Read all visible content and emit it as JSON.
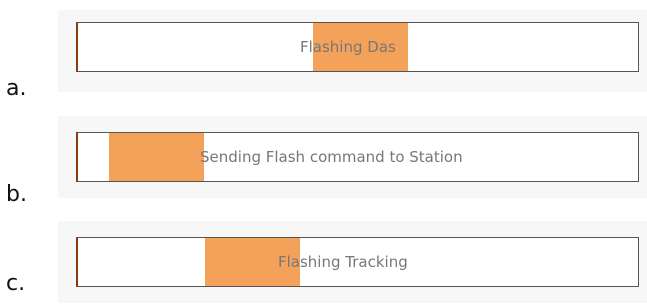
{
  "items": [
    {
      "label": "a.",
      "status_text": "Flashing Das",
      "segment_start_fraction": 0.42,
      "segment_width_fraction": 0.17
    },
    {
      "label": "b.",
      "status_text": "Sending Flash command to Station",
      "segment_start_fraction": 0.055,
      "segment_width_fraction": 0.17
    },
    {
      "label": "c.",
      "status_text": "Flashing Tracking",
      "segment_start_fraction": 0.226,
      "segment_width_fraction": 0.17
    }
  ],
  "colors": {
    "segment": "#f4a259",
    "text": "#777777",
    "label": "#111111",
    "bar_border": "#555555",
    "bar_left_edge": "#8b3a10",
    "panel": "#f7f7f7"
  }
}
